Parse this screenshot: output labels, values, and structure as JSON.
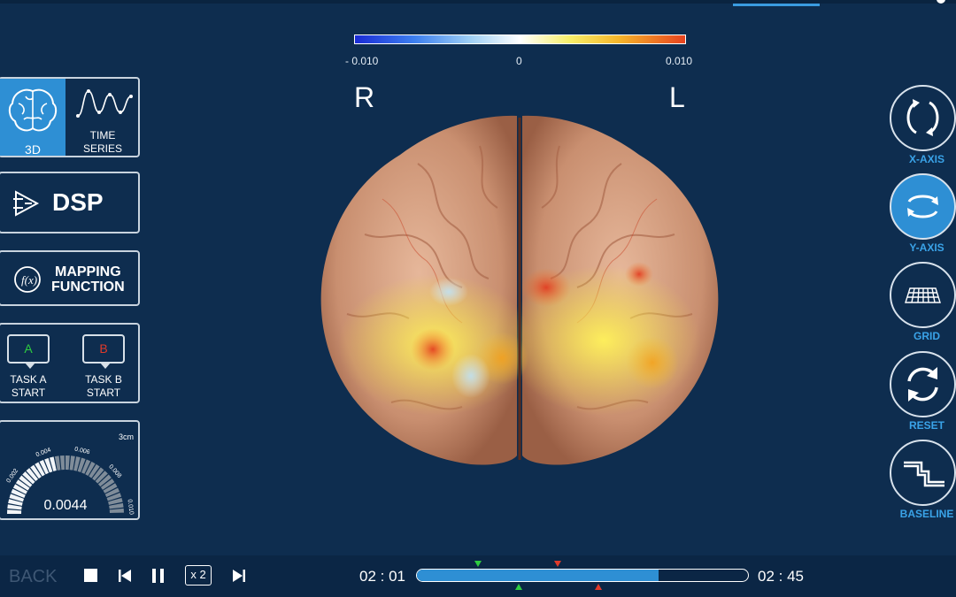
{
  "colors": {
    "background": "#0e2d4f",
    "accent": "#2e8fd4",
    "label_blue": "#3aa3e8",
    "task_a": "#2ecc40",
    "task_b": "#e03a2a"
  },
  "scale": {
    "min": "- 0.010",
    "mid": "0",
    "max": "0.010"
  },
  "orientation": {
    "right": "R",
    "left": "L"
  },
  "view_modes": [
    {
      "label": "3D",
      "icon": "brain-icon",
      "active": true
    },
    {
      "label_line1": "TIME",
      "label_line2": "SERIES",
      "icon": "waveform-icon",
      "active": false
    }
  ],
  "dsp": {
    "label": "DSP",
    "icon": "dsp-icon"
  },
  "mapping": {
    "line1": "MAPPING",
    "line2": "FUNCTION",
    "icon": "function-icon"
  },
  "tasks": [
    {
      "letter": "A",
      "line1": "TASK A",
      "line2": "START"
    },
    {
      "letter": "B",
      "line1": "TASK B",
      "line2": "START"
    }
  ],
  "gauge": {
    "unit": "3cm",
    "value": "0.0044",
    "ticks": [
      "0.002",
      "0.004",
      "0.006",
      "0.008",
      "0.010"
    ],
    "fill_fraction": 0.44
  },
  "right_controls": [
    {
      "label": "X-AXIS",
      "icon": "rotate-x-icon",
      "active": false
    },
    {
      "label": "Y-AXIS",
      "icon": "rotate-y-icon",
      "active": true
    },
    {
      "label": "GRID",
      "icon": "grid-icon",
      "active": false
    },
    {
      "label": "RESET",
      "icon": "reset-icon",
      "active": false
    },
    {
      "label": "BASELINE",
      "icon": "baseline-icon",
      "active": false
    }
  ],
  "playback": {
    "back_label": "BACK",
    "speed": "x 2",
    "current_time": "02 : 01",
    "total_time": "02 : 45",
    "progress": 0.73
  }
}
